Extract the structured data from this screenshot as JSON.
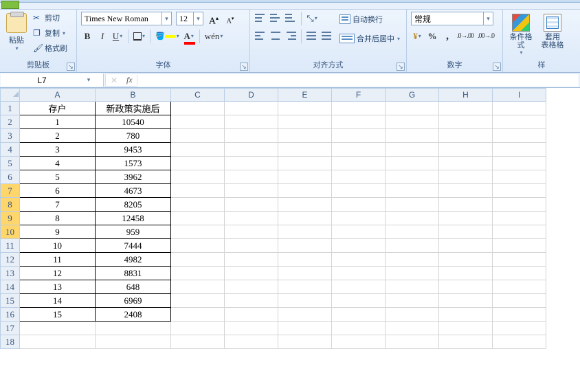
{
  "namebox": {
    "value": "L7"
  },
  "formula_bar": {
    "fx_label": "fx",
    "value": ""
  },
  "ribbon": {
    "clipboard": {
      "group_label": "剪贴板",
      "paste": "粘贴",
      "cut": "剪切",
      "copy": "复制",
      "format_painter": "格式刷"
    },
    "font": {
      "group_label": "字体",
      "font_name": "Times New Roman",
      "font_size": "12",
      "wen": "wén"
    },
    "align": {
      "group_label": "对齐方式",
      "wrap_text": "自动换行",
      "merge_center": "合并后居中"
    },
    "number": {
      "group_label": "数字",
      "format": "常规"
    },
    "styles": {
      "group_label": "样",
      "cond_fmt": "条件格式",
      "table_fmt_l1": "套用",
      "table_fmt_l2": "表格格"
    }
  },
  "columns": [
    "A",
    "B",
    "C",
    "D",
    "E",
    "F",
    "G",
    "H",
    "I"
  ],
  "row_headers": [
    1,
    2,
    3,
    4,
    5,
    6,
    7,
    8,
    9,
    10,
    11,
    12,
    13,
    14,
    15,
    16,
    17,
    18
  ],
  "highlight_rows": [
    7,
    8,
    9,
    10
  ],
  "data_header": {
    "a": "存户",
    "b": "新政策实施后"
  },
  "data_rows": [
    {
      "a": "1",
      "b": "10540"
    },
    {
      "a": "2",
      "b": "780"
    },
    {
      "a": "3",
      "b": "9453"
    },
    {
      "a": "4",
      "b": "1573"
    },
    {
      "a": "5",
      "b": "3962"
    },
    {
      "a": "6",
      "b": "4673"
    },
    {
      "a": "7",
      "b": "8205"
    },
    {
      "a": "8",
      "b": "12458"
    },
    {
      "a": "9",
      "b": "959"
    },
    {
      "a": "10",
      "b": "7444"
    },
    {
      "a": "11",
      "b": "4982"
    },
    {
      "a": "12",
      "b": "8831"
    },
    {
      "a": "13",
      "b": "648"
    },
    {
      "a": "14",
      "b": "6969"
    },
    {
      "a": "15",
      "b": "2408"
    }
  ],
  "chart_data": {
    "type": "table",
    "title": "新政策实施后",
    "columns": [
      "存户",
      "新政策实施后"
    ],
    "rows": [
      [
        1,
        10540
      ],
      [
        2,
        780
      ],
      [
        3,
        9453
      ],
      [
        4,
        1573
      ],
      [
        5,
        3962
      ],
      [
        6,
        4673
      ],
      [
        7,
        8205
      ],
      [
        8,
        12458
      ],
      [
        9,
        959
      ],
      [
        10,
        7444
      ],
      [
        11,
        4982
      ],
      [
        12,
        8831
      ],
      [
        13,
        648
      ],
      [
        14,
        6969
      ],
      [
        15,
        2408
      ]
    ]
  }
}
